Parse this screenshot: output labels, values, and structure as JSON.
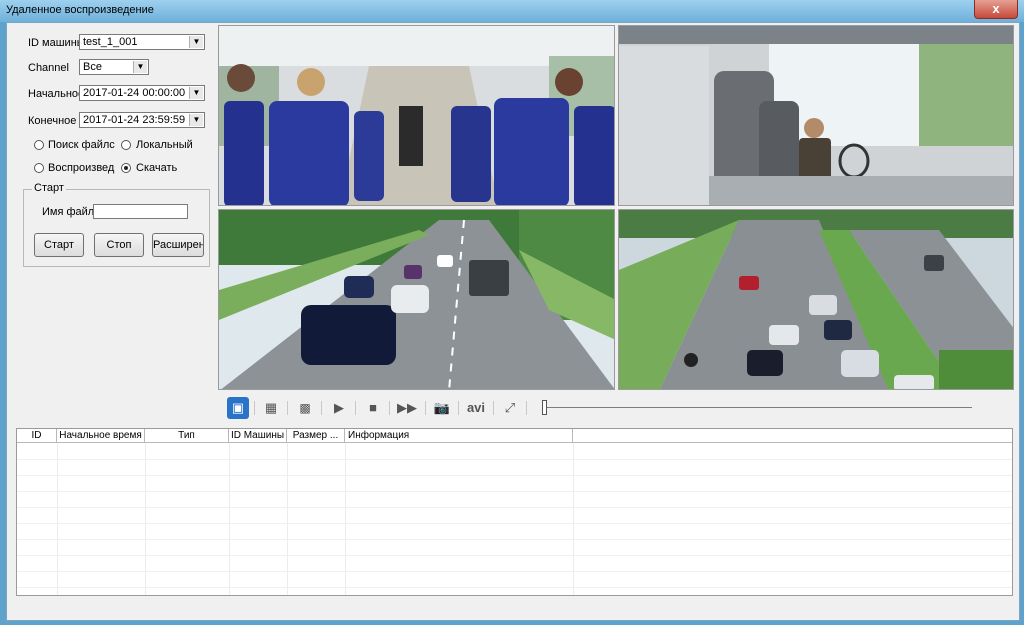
{
  "window": {
    "title": "Удаленное воспроизведение",
    "close_glyph": "x"
  },
  "form": {
    "machine_id": {
      "label": "ID машины",
      "value": "test_1_001"
    },
    "channel": {
      "label": "Channel",
      "value": "Все"
    },
    "start": {
      "label": "Начальное",
      "value": "2017-01-24 00:00:00"
    },
    "end": {
      "label": "Конечное в",
      "value": "2017-01-24 23:59:59"
    },
    "radios": [
      {
        "label": "Поиск файлс",
        "checked": false
      },
      {
        "label": "Локальный ф",
        "checked": false
      },
      {
        "label": "Воспроизвед",
        "checked": false
      },
      {
        "label": "Скачать",
        "checked": true
      }
    ]
  },
  "download_group": {
    "title": "Старт",
    "filename_label": "Имя файла",
    "filename_value": "",
    "buttons": {
      "start": "Старт",
      "stop": "Стоп",
      "advanced": "Расширенны"
    }
  },
  "videos": [
    "bus-interior",
    "bus-driver",
    "highway-cars",
    "highway-traffic"
  ],
  "toolbar": {
    "icons": [
      "single-view-icon",
      "grid-9-icon",
      "grid-16-icon",
      "play-icon",
      "stop-icon",
      "fast-forward-icon",
      "camera-icon",
      "avi-icon",
      "fullscreen-icon"
    ],
    "avi_label": "avi"
  },
  "table": {
    "columns": [
      "ID",
      "Начальное время",
      "Тип",
      "ID Машины",
      "Размер ...",
      "Информация"
    ],
    "rows": []
  }
}
